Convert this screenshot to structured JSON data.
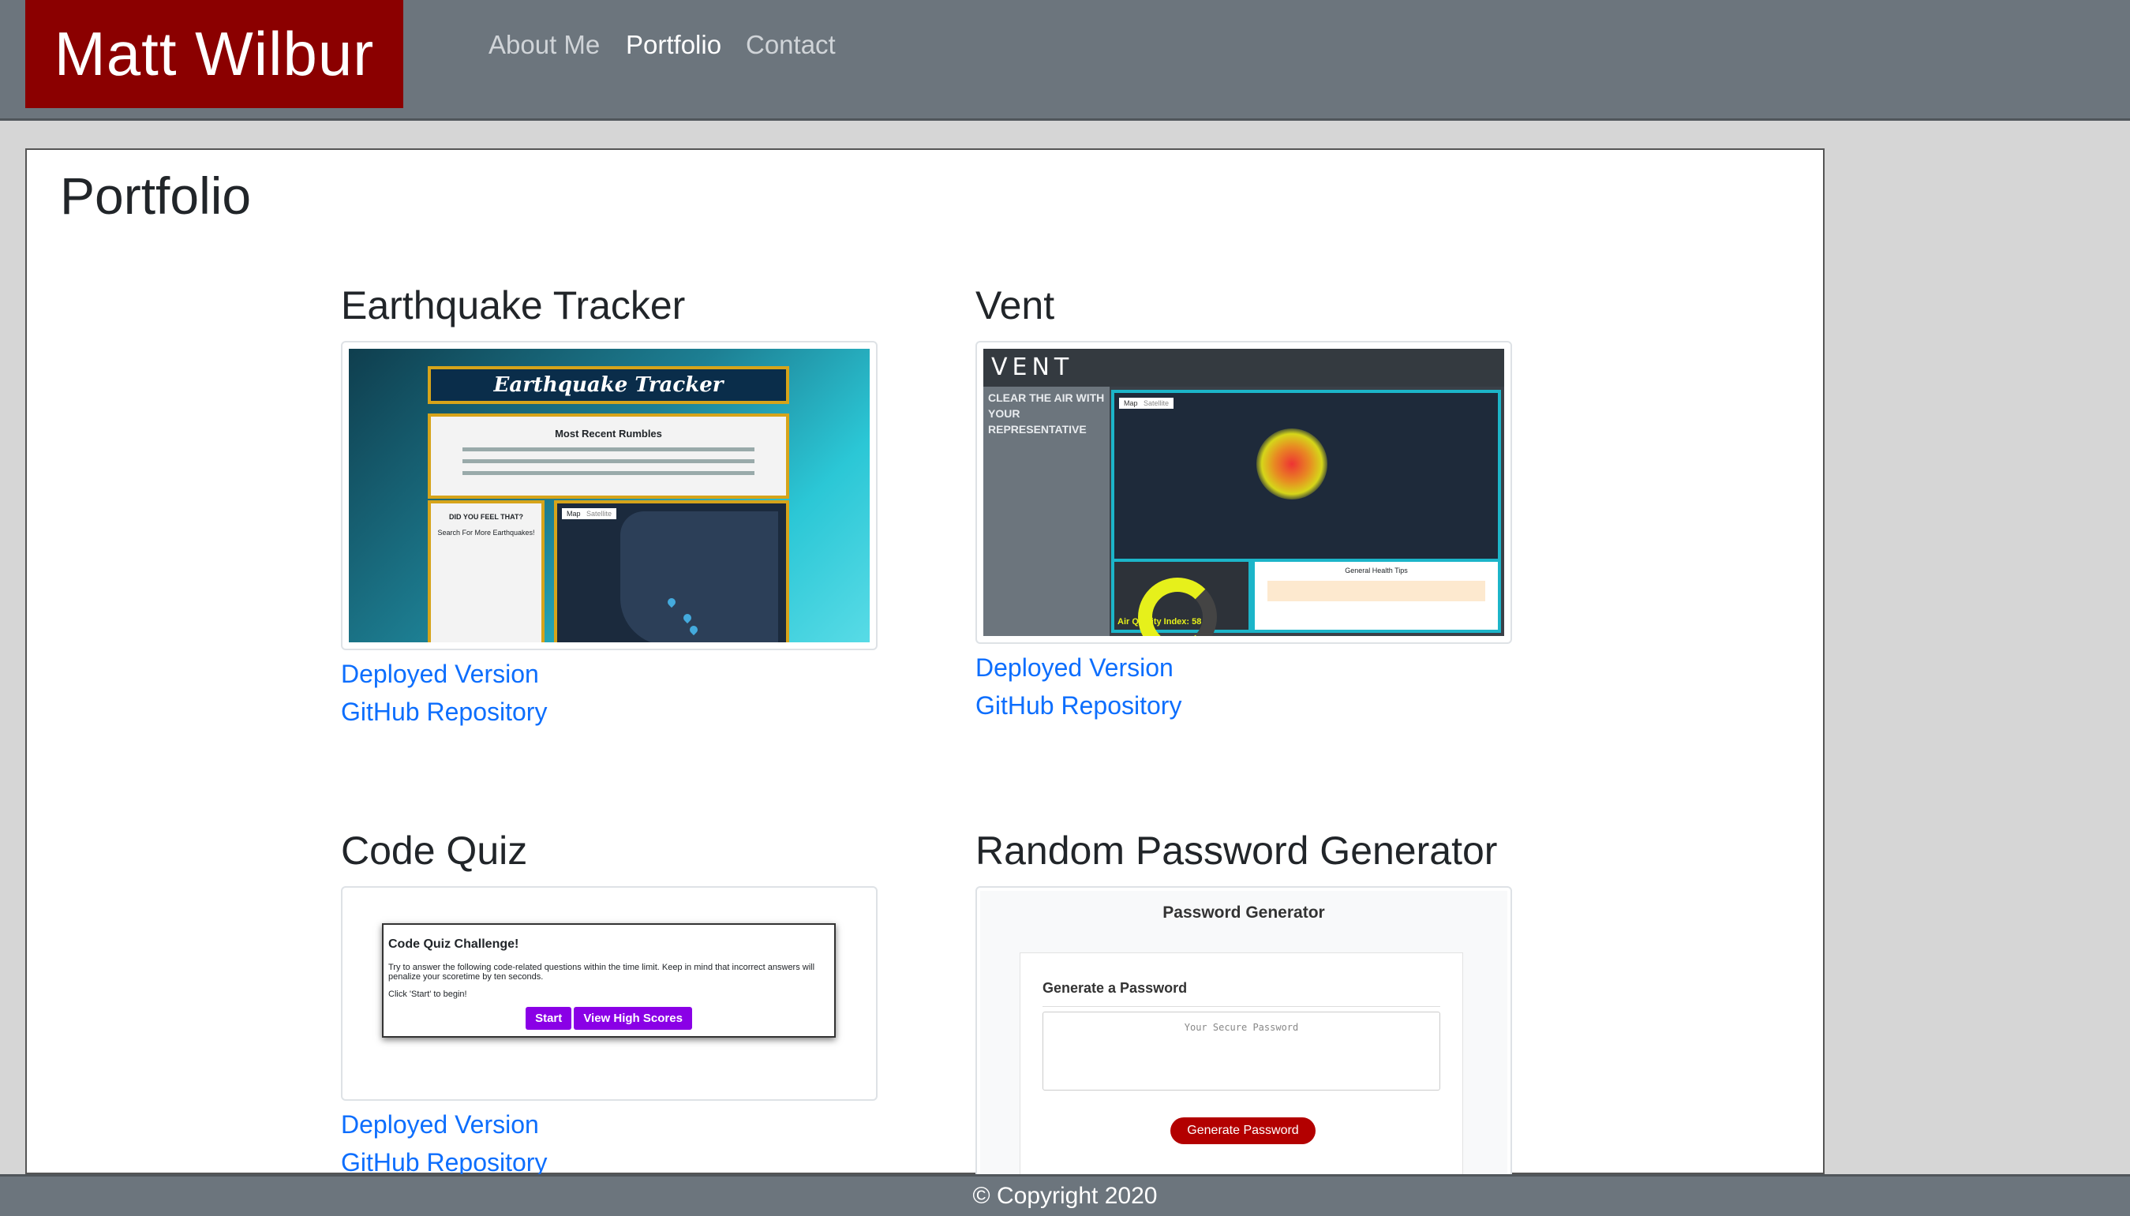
{
  "header": {
    "brand": "Matt Wilbur",
    "nav": [
      {
        "label": "About Me",
        "active": false
      },
      {
        "label": "Portfolio",
        "active": true
      },
      {
        "label": "Contact",
        "active": false
      }
    ]
  },
  "main": {
    "title": "Portfolio",
    "projects": [
      {
        "title": "Earthquake Tracker",
        "deployed_label": "Deployed Version",
        "repo_label": "GitHub Repository",
        "thumb": {
          "heading": "Earthquake Tracker",
          "rumbles_title": "Most Recent Rumbles",
          "form_title": "DID YOU FEEL THAT?",
          "form_sub": "Search For More Earthquakes!",
          "map_tab": "Map",
          "satellite_tab": "Satellite"
        }
      },
      {
        "title": "Vent",
        "deployed_label": "Deployed Version",
        "repo_label": "GitHub Repository",
        "thumb": {
          "logo": "VENT",
          "tagline": "CLEAR THE AIR WITH YOUR REPRESENTATIVE",
          "map_tab": "Map",
          "satellite_tab": "Satellite",
          "aqi_label": "Air Quality Index: 58",
          "tips_title": "General Health Tips"
        }
      },
      {
        "title": "Code Quiz",
        "deployed_label": "Deployed Version",
        "repo_label": "GitHub Repository",
        "thumb": {
          "heading": "Code Quiz Challenge!",
          "body": "Try to answer the following code-related questions within the time limit. Keep in mind that incorrect answers will penalize your scoretime by ten seconds.",
          "hint": "Click 'Start' to begin!",
          "start": "Start",
          "scores": "View High Scores"
        }
      },
      {
        "title": "Random Password Generator",
        "thumb": {
          "heading": "Password Generator",
          "card_title": "Generate a Password",
          "placeholder": "Your Secure Password",
          "button": "Generate Password"
        }
      }
    ]
  },
  "footer": {
    "copyright": "© Copyright 2020"
  }
}
